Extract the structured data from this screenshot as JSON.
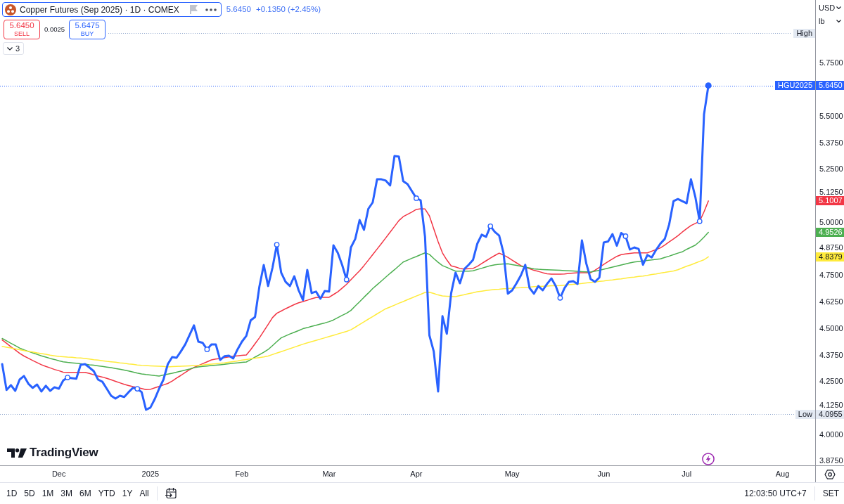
{
  "legend": {
    "title": "Copper Futures (Sep 2025) · 1D · COMEX",
    "highlighted": true,
    "last": "5.6450",
    "change": "+0.1350 (+2.45%)"
  },
  "trade": {
    "buttons": [
      {
        "kind": "sell",
        "price": "5.6450",
        "label": "SELL"
      },
      {
        "kind": "buy",
        "price": "5.6475",
        "label": "BUY"
      }
    ],
    "spread": "0.0025"
  },
  "indicators": {
    "count": "3"
  },
  "price_scale": {
    "dropdowns": [
      "USD",
      "lb"
    ],
    "series_tags": [
      "5.6450",
      "5.1007",
      "4.9526",
      "4.8379"
    ],
    "low_tag": "4.0955"
  },
  "chart_data": {
    "type": "line",
    "categories": [
      null,
      null,
      null,
      null,
      null,
      null,
      null,
      null,
      null,
      null,
      null,
      null,
      null,
      "Dec",
      null,
      null,
      null,
      null,
      null,
      null,
      null,
      null,
      null,
      null,
      null,
      null,
      null,
      null,
      null,
      null,
      null,
      null,
      null,
      null,
      "2025",
      null,
      null,
      null,
      null,
      null,
      null,
      null,
      null,
      null,
      null,
      null,
      null,
      null,
      null,
      null,
      null,
      null,
      null,
      null,
      null,
      "Feb",
      null,
      null,
      null,
      null,
      null,
      null,
      null,
      null,
      null,
      null,
      null,
      null,
      null,
      null,
      null,
      null,
      null,
      null,
      null,
      "Mar",
      null,
      null,
      null,
      null,
      null,
      null,
      null,
      null,
      null,
      null,
      null,
      null,
      null,
      null,
      null,
      null,
      null,
      null,
      null,
      "Apr",
      null,
      null,
      null,
      null,
      null,
      null,
      null,
      null,
      null,
      null,
      null,
      null,
      null,
      null,
      null,
      null,
      null,
      null,
      null,
      null,
      null,
      "May",
      null,
      null,
      null,
      null,
      null,
      null,
      null,
      null,
      null,
      null,
      null,
      null,
      null,
      null,
      null,
      null,
      null,
      null,
      null,
      null,
      "Jun",
      null,
      null,
      null,
      null,
      null,
      null,
      null,
      null,
      null,
      null,
      null,
      null,
      null,
      null,
      null,
      null,
      null,
      null,
      "Jul",
      null,
      null,
      null,
      null,
      null,
      null,
      null,
      null,
      null,
      null,
      null,
      null,
      null,
      null,
      null,
      null,
      null,
      null,
      null,
      null,
      null,
      "Aug",
      null,
      null,
      null,
      null,
      null,
      null,
      null
    ],
    "ylim": [
      3.855,
      6.048
    ],
    "yticks": [
      {
        "value": 3.875,
        "label": "3.8750"
      },
      {
        "value": 4,
        "label": "4.0000"
      },
      {
        "value": 4.125,
        "label": "4.1250"
      },
      {
        "value": 4.25,
        "label": "4.2500"
      },
      {
        "value": 4.375,
        "label": "4.3750"
      },
      {
        "value": 4.5,
        "label": "4.5000"
      },
      {
        "value": 4.625,
        "label": "4.6250"
      },
      {
        "value": 4.75,
        "label": "4.7500"
      },
      {
        "value": 4.875,
        "label": "4.8750"
      },
      {
        "value": 5,
        "label": "5.0000"
      },
      {
        "value": 5.125,
        "label": "5.1250"
      },
      {
        "value": 5.25,
        "label": "5.2500"
      },
      {
        "value": 5.375,
        "label": "5.3750"
      },
      {
        "value": 5.5,
        "label": "5.5000"
      },
      {
        "value": 5.75,
        "label": "5.7500"
      }
    ],
    "series": [
      {
        "color": "#2962ff",
        "values": [
          4.332,
          4.21,
          4.233,
          4.206,
          4.259,
          4.276,
          4.24,
          4.22,
          4.236,
          4.203,
          4.23,
          4.206,
          4.223,
          4.216,
          4.255,
          4.269,
          4.266,
          4.263,
          4.329,
          4.332,
          4.316,
          4.299,
          4.259,
          4.249,
          4.216,
          4.183,
          4.17,
          4.183,
          4.177,
          4.2,
          4.22,
          4.216,
          4.2,
          4.117,
          4.127,
          4.167,
          4.216,
          4.259,
          4.332,
          4.365,
          4.362,
          4.392,
          4.425,
          4.47,
          4.515,
          4.438,
          4.432,
          4.402,
          4.425,
          4.425,
          4.352,
          4.369,
          4.372,
          4.359,
          4.402,
          4.438,
          4.465,
          4.538,
          4.554,
          4.697,
          4.799,
          4.7,
          4.786,
          4.895,
          4.763,
          4.72,
          4.7,
          4.746,
          4.68,
          4.634,
          4.776,
          4.667,
          4.674,
          4.64,
          4.677,
          4.674,
          4.892,
          4.856,
          4.799,
          4.73,
          4.882,
          4.922,
          5.011,
          4.965,
          5.064,
          5.094,
          5.203,
          5.203,
          5.197,
          5.174,
          5.313,
          5.31,
          5.194,
          5.18,
          5.147,
          5.114,
          5.104,
          4.932,
          4.468,
          4.392,
          4.203,
          4.558,
          4.475,
          4.667,
          4.763,
          4.713,
          4.78,
          4.8,
          4.823,
          4.9,
          4.942,
          4.932,
          4.982,
          4.955,
          4.938,
          4.856,
          4.664,
          4.68,
          4.713,
          4.75,
          4.8,
          4.69,
          4.664,
          4.7,
          4.68,
          4.71,
          4.736,
          4.7,
          4.644,
          4.69,
          4.72,
          4.723,
          4.71,
          4.915,
          4.806,
          4.733,
          4.72,
          4.74,
          4.905,
          4.91,
          4.945,
          4.89,
          4.95,
          4.935,
          4.872,
          4.882,
          4.875,
          4.8,
          4.846,
          4.835,
          4.87,
          4.9,
          4.922,
          4.99,
          5.1,
          5.11,
          5.1,
          5.09,
          5.203,
          5.12,
          5.005,
          5.51,
          5.645,
          null,
          null,
          null,
          null,
          null,
          null,
          null,
          null,
          null,
          null,
          null,
          null,
          null,
          null,
          null,
          null,
          null,
          null,
          null,
          null,
          null,
          null,
          null,
          null
        ]
      },
      {
        "color": "#f23645",
        "values": [
          4.446,
          4.43,
          4.414,
          4.399,
          4.383,
          4.37,
          4.36,
          4.349,
          4.339,
          4.329,
          4.321,
          4.314,
          4.307,
          4.301,
          4.294,
          4.293,
          4.293,
          4.293,
          4.293,
          4.293,
          4.288,
          4.282,
          4.276,
          4.271,
          4.265,
          4.258,
          4.251,
          4.244,
          4.237,
          4.231,
          4.226,
          4.222,
          4.217,
          4.212,
          4.213,
          4.22,
          4.227,
          4.234,
          4.241,
          4.252,
          4.266,
          4.279,
          4.293,
          4.306,
          4.316,
          4.325,
          4.334,
          4.343,
          4.352,
          4.356,
          4.359,
          4.363,
          4.366,
          4.369,
          4.371,
          4.373,
          4.375,
          4.4,
          4.428,
          4.456,
          4.487,
          4.519,
          4.551,
          4.572,
          4.582,
          4.593,
          4.603,
          4.613,
          4.621,
          4.627,
          4.633,
          4.64,
          4.646,
          4.647,
          4.647,
          4.647,
          4.66,
          4.673,
          4.69,
          4.708,
          4.73,
          4.751,
          4.772,
          4.796,
          4.822,
          4.848,
          4.874,
          4.9,
          4.927,
          4.954,
          4.981,
          5.008,
          5.027,
          5.038,
          5.049,
          5.061,
          5.064,
          5.063,
          5.031,
          4.97,
          4.909,
          4.856,
          4.823,
          4.795,
          4.79,
          4.783,
          4.78,
          4.782,
          4.783,
          4.793,
          4.806,
          4.819,
          4.832,
          4.844,
          4.855,
          4.846,
          4.835,
          4.822,
          4.809,
          4.796,
          4.789,
          4.782,
          4.774,
          4.769,
          4.763,
          4.758,
          4.756,
          4.756,
          4.756,
          4.757,
          4.759,
          4.761,
          4.763,
          4.763,
          4.763,
          4.763,
          4.775,
          4.788,
          4.802,
          4.815,
          4.828,
          4.84,
          4.848,
          4.851,
          4.854,
          4.856,
          4.856,
          4.856,
          4.856,
          4.864,
          4.872,
          4.88,
          4.893,
          4.908,
          4.922,
          4.937,
          4.954,
          4.97,
          4.985,
          4.995,
          5.005,
          5.05,
          5.101,
          null,
          null,
          null,
          null,
          null,
          null,
          null,
          null,
          null,
          null,
          null,
          null,
          null,
          null,
          null,
          null,
          null,
          null,
          null,
          null,
          null,
          null,
          null,
          null
        ]
      },
      {
        "color": "#4caf50",
        "values": [
          4.453,
          4.442,
          4.43,
          4.419,
          4.408,
          4.399,
          4.392,
          4.385,
          4.378,
          4.371,
          4.365,
          4.359,
          4.354,
          4.348,
          4.343,
          4.34,
          4.338,
          4.336,
          4.334,
          4.332,
          4.329,
          4.327,
          4.324,
          4.321,
          4.318,
          4.315,
          4.311,
          4.308,
          4.304,
          4.3,
          4.295,
          4.29,
          4.286,
          4.283,
          4.281,
          4.278,
          4.276,
          4.281,
          4.285,
          4.289,
          4.294,
          4.299,
          4.304,
          4.309,
          4.315,
          4.319,
          4.321,
          4.323,
          4.325,
          4.327,
          4.329,
          4.331,
          4.334,
          4.336,
          4.338,
          4.34,
          4.342,
          4.353,
          4.365,
          4.376,
          4.388,
          4.401,
          4.419,
          4.438,
          4.456,
          4.465,
          4.474,
          4.482,
          4.49,
          4.499,
          4.504,
          4.51,
          4.515,
          4.521,
          4.526,
          4.532,
          4.54,
          4.551,
          4.562,
          4.572,
          4.585,
          4.606,
          4.626,
          4.647,
          4.667,
          4.688,
          4.706,
          4.724,
          4.742,
          4.76,
          4.777,
          4.795,
          4.813,
          4.822,
          4.831,
          4.839,
          4.848,
          4.856,
          4.849,
          4.83,
          4.812,
          4.796,
          4.788,
          4.779,
          4.77,
          4.77,
          4.77,
          4.77,
          4.772,
          4.778,
          4.784,
          4.79,
          4.796,
          4.8,
          4.802,
          4.804,
          4.805,
          4.801,
          4.797,
          4.793,
          4.789,
          4.785,
          4.781,
          4.779,
          4.778,
          4.777,
          4.776,
          4.775,
          4.774,
          4.773,
          4.772,
          4.771,
          4.769,
          4.768,
          4.767,
          4.766,
          4.77,
          4.774,
          4.779,
          4.784,
          4.789,
          4.794,
          4.799,
          4.804,
          4.809,
          4.813,
          4.816,
          4.818,
          4.821,
          4.823,
          4.826,
          4.828,
          4.835,
          4.841,
          4.848,
          4.855,
          4.861,
          4.873,
          4.883,
          4.893,
          4.91,
          4.931,
          4.953,
          null,
          null,
          null,
          null,
          null,
          null,
          null,
          null,
          null,
          null,
          null,
          null,
          null,
          null,
          null,
          null,
          null,
          null,
          null,
          null,
          null,
          null,
          null,
          null
        ]
      },
      {
        "color": "#ffeb3b",
        "values": [
          4.416,
          4.412,
          4.408,
          4.404,
          4.4,
          4.396,
          4.392,
          4.389,
          4.385,
          4.382,
          4.378,
          4.374,
          4.371,
          4.368,
          4.367,
          4.365,
          4.364,
          4.362,
          4.361,
          4.359,
          4.356,
          4.353,
          4.351,
          4.348,
          4.345,
          4.343,
          4.341,
          4.338,
          4.336,
          4.333,
          4.331,
          4.328,
          4.326,
          4.325,
          4.324,
          4.323,
          4.322,
          4.321,
          4.319,
          4.32,
          4.321,
          4.322,
          4.323,
          4.324,
          4.325,
          4.326,
          4.328,
          4.33,
          4.332,
          4.334,
          4.336,
          4.338,
          4.341,
          4.344,
          4.347,
          4.351,
          4.354,
          4.357,
          4.36,
          4.363,
          4.366,
          4.37,
          4.377,
          4.384,
          4.391,
          4.398,
          4.405,
          4.412,
          4.419,
          4.426,
          4.432,
          4.438,
          4.444,
          4.45,
          4.456,
          4.462,
          4.468,
          4.474,
          4.48,
          4.486,
          4.494,
          4.506,
          4.519,
          4.531,
          4.544,
          4.556,
          4.569,
          4.581,
          4.593,
          4.601,
          4.61,
          4.619,
          4.627,
          4.636,
          4.644,
          4.653,
          4.661,
          4.67,
          4.671,
          4.665,
          4.658,
          4.653,
          4.652,
          4.651,
          4.65,
          4.655,
          4.659,
          4.664,
          4.668,
          4.673,
          4.676,
          4.679,
          4.682,
          4.684,
          4.685,
          4.687,
          4.688,
          4.69,
          4.691,
          4.692,
          4.694,
          4.695,
          4.697,
          4.698,
          4.699,
          4.7,
          4.701,
          4.701,
          4.702,
          4.704,
          4.706,
          4.708,
          4.71,
          4.712,
          4.715,
          4.717,
          4.719,
          4.722,
          4.724,
          4.727,
          4.729,
          4.732,
          4.734,
          4.737,
          4.74,
          4.742,
          4.745,
          4.747,
          4.75,
          4.754,
          4.757,
          4.761,
          4.764,
          4.768,
          4.771,
          4.777,
          4.785,
          4.793,
          4.8,
          4.808,
          4.816,
          4.824,
          4.838,
          null,
          null,
          null,
          null,
          null,
          null,
          null,
          null,
          null,
          null,
          null,
          null,
          null,
          null,
          null,
          null,
          null,
          null,
          null,
          null,
          null,
          null,
          null,
          null
        ]
      },
      {
        "color": "#2962ff",
        "marker": "o",
        "values": [
          null,
          null,
          null,
          null,
          null,
          null,
          null,
          null,
          null,
          null,
          null,
          null,
          null,
          null,
          null,
          4.269,
          null,
          null,
          null,
          null,
          null,
          null,
          null,
          null,
          null,
          null,
          null,
          null,
          null,
          null,
          null,
          4.216,
          null,
          null,
          null,
          null,
          null,
          null,
          null,
          null,
          null,
          null,
          null,
          null,
          null,
          null,
          null,
          4.402,
          null,
          null,
          null,
          null,
          null,
          null,
          null,
          null,
          null,
          null,
          null,
          null,
          null,
          null,
          null,
          4.895,
          null,
          null,
          null,
          null,
          null,
          null,
          null,
          null,
          null,
          null,
          null,
          null,
          null,
          null,
          null,
          4.73,
          null,
          null,
          null,
          null,
          null,
          null,
          null,
          null,
          null,
          null,
          null,
          null,
          null,
          null,
          null,
          5.114,
          null,
          null,
          null,
          null,
          null,
          null,
          null,
          null,
          null,
          null,
          null,
          null,
          null,
          null,
          null,
          null,
          4.982,
          null,
          null,
          null,
          null,
          null,
          null,
          null,
          null,
          null,
          null,
          null,
          null,
          null,
          null,
          null,
          4.644,
          null,
          null,
          null,
          null,
          null,
          null,
          null,
          null,
          null,
          null,
          null,
          null,
          null,
          null,
          4.935,
          null,
          null,
          null,
          null,
          null,
          null,
          null,
          null,
          null,
          null,
          null,
          null,
          null,
          null,
          null,
          null,
          5.005,
          null,
          null,
          null,
          null,
          null,
          null,
          null,
          null,
          null,
          null,
          null,
          null,
          null,
          null,
          null,
          null,
          null,
          null,
          null,
          null,
          null,
          null,
          null,
          null,
          null,
          null
        ]
      }
    ],
    "ref_lines": [
      {
        "axis": "y",
        "value": 5.892,
        "label": "High",
        "color": "#8fa6cc"
      },
      {
        "axis": "y",
        "value": 5.645,
        "label": "HGU2025",
        "color": "#2962ff"
      },
      {
        "axis": "y",
        "value": 4.0955,
        "label": "Low",
        "color": "#8fa6cc"
      }
    ]
  },
  "logo": {
    "text": "TradingView"
  },
  "toolbar": {
    "ranges": [
      "1D",
      "5D",
      "1M",
      "3M",
      "6M",
      "YTD",
      "1Y",
      "All"
    ],
    "time": "12:03:50 UTC+7",
    "session": "SET"
  }
}
